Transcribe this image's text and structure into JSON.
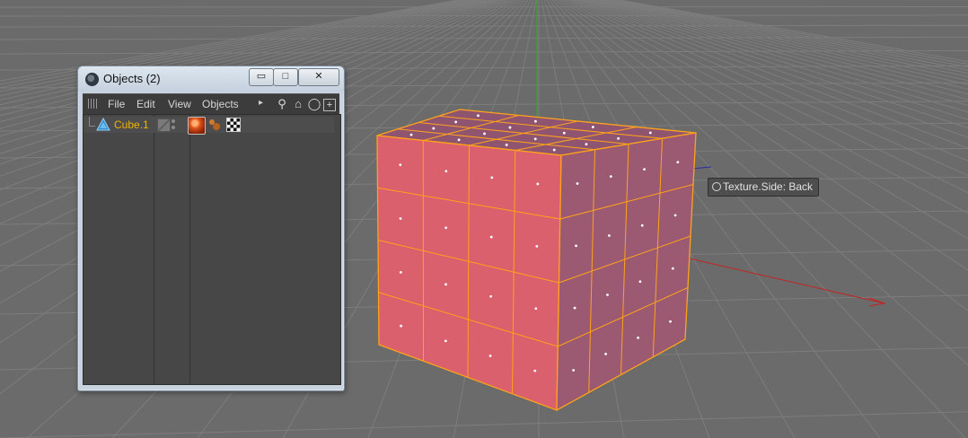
{
  "window": {
    "title": "Objects (2)",
    "buttons": {
      "minimize": "▭",
      "maximize": "□",
      "close": "✕"
    }
  },
  "menu": {
    "items": [
      "File",
      "Edit",
      "View",
      "Objects"
    ],
    "arrow": "▸"
  },
  "toolbar": {
    "icons": [
      "search-icon",
      "home-icon",
      "eye-icon",
      "new-object-icon"
    ]
  },
  "objects": [
    {
      "name": "Cube.1",
      "icon": "cube-icon",
      "tags": [
        "material-tag-icon",
        "phong-tag-icon",
        "uvw-tag-icon"
      ],
      "name_color": "#f0b400"
    }
  ],
  "viewport": {
    "tooltip": "Texture.Side: Back",
    "cube_front_color": "#d9606c",
    "cube_side_color": "#9b5a72",
    "cube_edge_color": "#ffa21a",
    "grid_color": "#7d7d7d",
    "background_color": "#6b6b6b",
    "axis_x_color": "#c52323",
    "axis_y_color": "#26b326",
    "axis_z_color": "#2a2aa8"
  }
}
